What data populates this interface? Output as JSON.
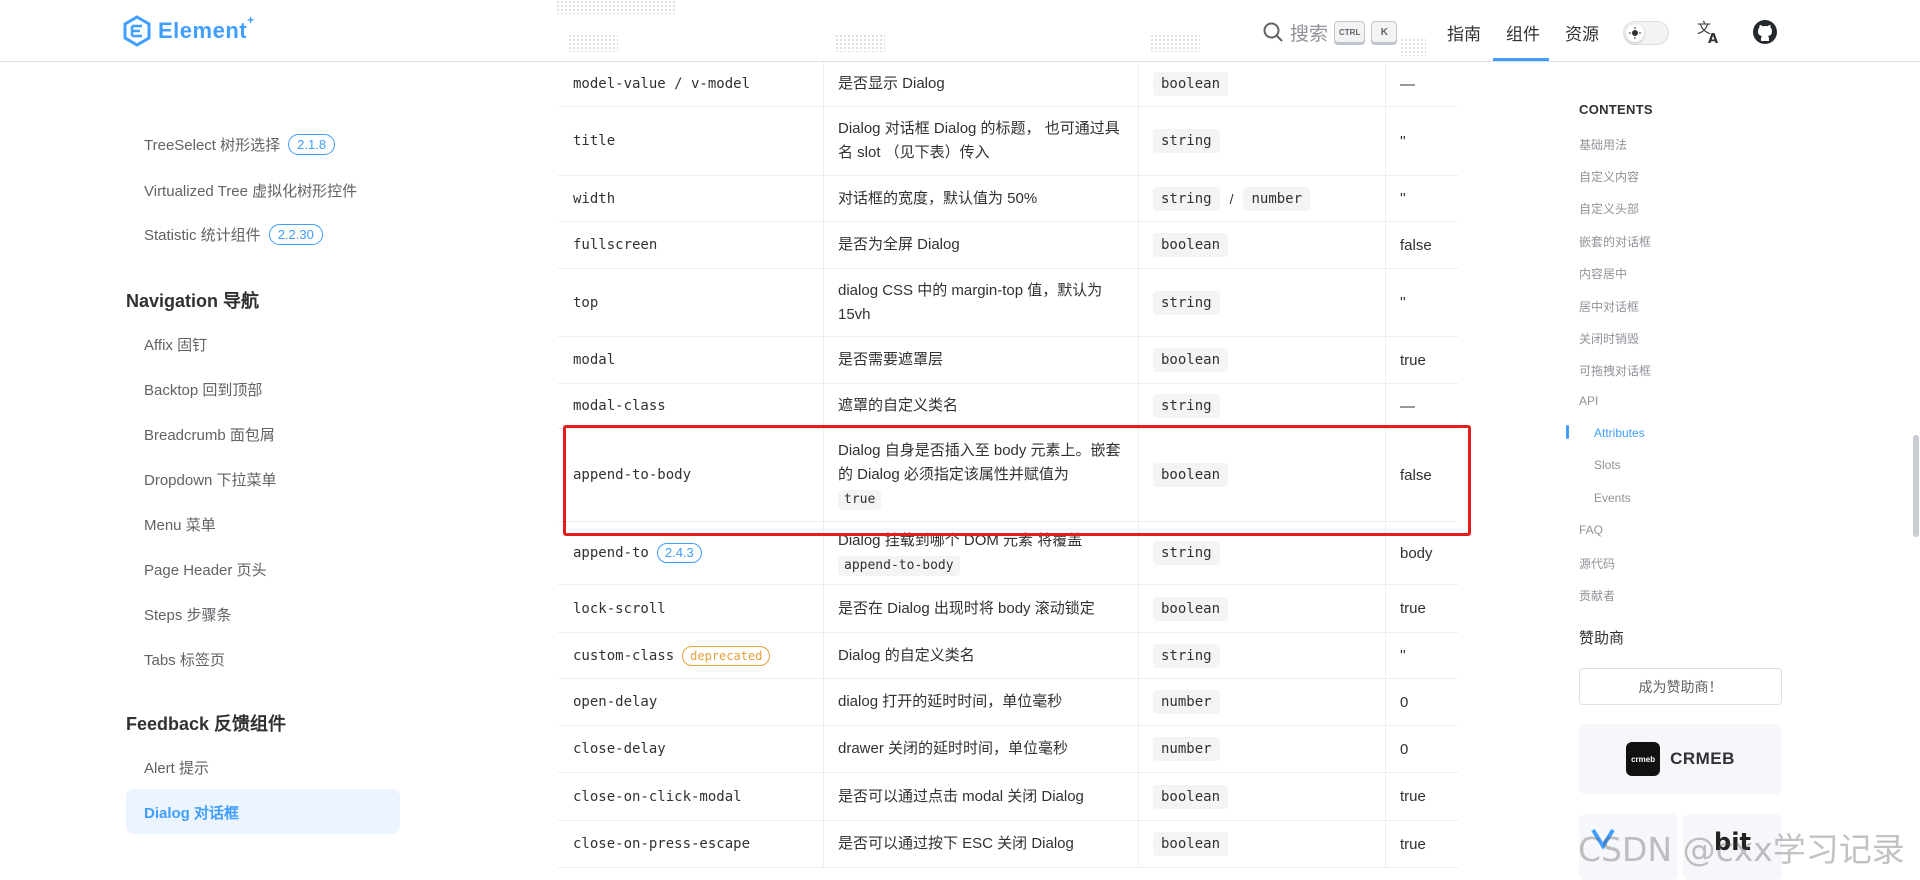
{
  "header": {
    "logo_text": "Element",
    "logo_sup": "+",
    "search_label": "搜索",
    "kbd_ctrl": "CTRL",
    "kbd_k": "K",
    "nav": [
      "指南",
      "组件",
      "资源"
    ],
    "active_nav": "组件"
  },
  "sidebar": {
    "items_top": [
      {
        "label": "TreeSelect 树形选择",
        "badge": "2.1.8"
      },
      {
        "label": "Virtualized Tree 虚拟化树形控件",
        "badge": ""
      },
      {
        "label": "Statistic 统计组件",
        "badge": "2.2.30"
      }
    ],
    "group_navigation": "Navigation 导航",
    "navigation_items": [
      "Affix 固钉",
      "Backtop 回到顶部",
      "Breadcrumb 面包屑",
      "Dropdown 下拉菜单",
      "Menu 菜单",
      "Page Header 页头",
      "Steps 步骤条",
      "Tabs 标签页"
    ],
    "group_feedback": "Feedback 反馈组件",
    "feedback_items": [
      "Alert 提示",
      "Dialog 对话框"
    ],
    "active_item": "Dialog 对话框"
  },
  "table": {
    "rows": [
      {
        "name": "model-value / v-model",
        "desc": "是否显示 Dialog",
        "types": [
          "boolean"
        ],
        "default": "—"
      },
      {
        "name": "title",
        "desc": "Dialog 对话框 Dialog 的标题， 也可通过具名 slot （见下表）传入",
        "types": [
          "string"
        ],
        "default": "''"
      },
      {
        "name": "width",
        "desc": "对话框的宽度，默认值为 50%",
        "types": [
          "string",
          "number"
        ],
        "default": "''"
      },
      {
        "name": "fullscreen",
        "desc": "是否为全屏 Dialog",
        "types": [
          "boolean"
        ],
        "default": "false"
      },
      {
        "name": "top",
        "desc": "dialog CSS 中的 margin-top 值，默认为 15vh",
        "types": [
          "string"
        ],
        "default": "''"
      },
      {
        "name": "modal",
        "desc": "是否需要遮罩层",
        "types": [
          "boolean"
        ],
        "default": "true"
      },
      {
        "name": "modal-class",
        "desc": "遮罩的自定义类名",
        "types": [
          "string"
        ],
        "default": "—"
      },
      {
        "name": "append-to-body",
        "desc": "Dialog 自身是否插入至 body 元素上。嵌套的 Dialog 必须指定该属性并赋值为",
        "desc_code": "true",
        "types": [
          "boolean"
        ],
        "default": "false"
      },
      {
        "name": "append-to",
        "name_badge": "2.4.3",
        "desc": "Dialog 挂载到哪个 DOM 元素 将覆盖",
        "desc_code": "append-to-body",
        "types": [
          "string"
        ],
        "default": "body"
      },
      {
        "name": "lock-scroll",
        "desc": "是否在 Dialog 出现时将 body 滚动锁定",
        "types": [
          "boolean"
        ],
        "default": "true"
      },
      {
        "name": "custom-class",
        "name_dep": "deprecated",
        "desc": "Dialog 的自定义类名",
        "types": [
          "string"
        ],
        "default": "''"
      },
      {
        "name": "open-delay",
        "desc": "dialog 打开的延时时间，单位毫秒",
        "types": [
          "number"
        ],
        "default": "0"
      },
      {
        "name": "close-delay",
        "desc": "drawer 关闭的延时时间，单位毫秒",
        "types": [
          "number"
        ],
        "default": "0"
      },
      {
        "name": "close-on-click-modal",
        "desc": "是否可以通过点击 modal 关闭 Dialog",
        "types": [
          "boolean"
        ],
        "default": "true"
      },
      {
        "name": "close-on-press-escape",
        "desc": "是否可以通过按下 ESC 关闭 Dialog",
        "types": [
          "boolean"
        ],
        "default": "true"
      }
    ],
    "type_separator": "/"
  },
  "toc": {
    "title": "CONTENTS",
    "items": [
      "基础用法",
      "自定义内容",
      "自定义头部",
      "嵌套的对话框",
      "内容居中",
      "居中对话框",
      "关闭时销毁",
      "可拖拽对话框",
      "API",
      "Attributes",
      "Slots",
      "Events",
      "FAQ",
      "源代码",
      "贡献者"
    ],
    "active": "Attributes",
    "sponsor_title": "赞助商",
    "sponsor_button": "成为赞助商！",
    "sponsor_crmeb_logo": "crmeb",
    "sponsor_crmeb": "CRMEB",
    "sponsor_bit": "bit"
  },
  "watermark": "CSDN @cxx学习记录",
  "colors": {
    "accent": "#409eff",
    "highlight": "#e51d1d",
    "deprecated": "#e6a23c"
  }
}
